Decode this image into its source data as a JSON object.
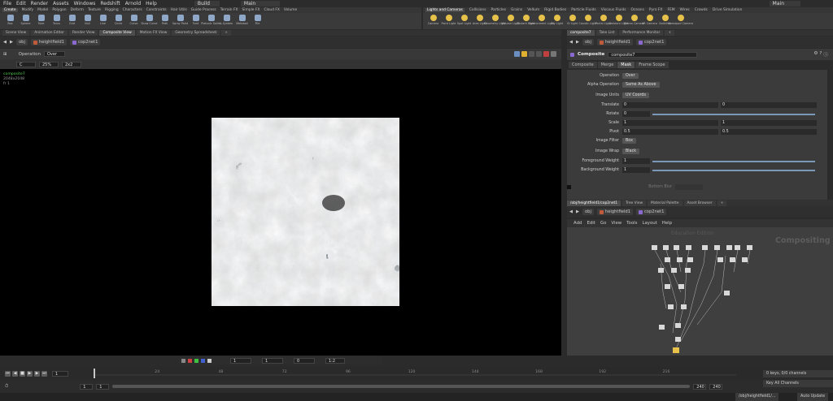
{
  "menus": [
    "File",
    "Edit",
    "Render",
    "Assets",
    "Windows",
    "Redshift",
    "Arnold",
    "Help"
  ],
  "desktop": "Build",
  "network_context": "Main",
  "user": "Main",
  "shelf_tabs_left": [
    "Create",
    "Modify",
    "Model",
    "Polygon",
    "Deform",
    "Texture",
    "Rigging",
    "Characters",
    "Constraints",
    "Hair Utils",
    "Guide Process",
    "Terrain FX",
    "Simple FX",
    "Cloud FX",
    "Volume"
  ],
  "shelf_tabs_right": [
    "Lights and Cameras",
    "Collisions",
    "Particles",
    "Grains",
    "Vellum",
    "Rigid Bodies",
    "Particle Fluids",
    "Viscous Fluids",
    "Oceans",
    "Pyro FX",
    "FEM",
    "Wires",
    "Crowds",
    "Drive Simulation"
  ],
  "shelf_tools_left": [
    "Box",
    "Sphere",
    "Tube",
    "Torus",
    "Grid",
    "Null",
    "Line",
    "Circle",
    "Curve",
    "Draw Curve",
    "Path",
    "Spray Paint",
    "Font",
    "Platonic Solids",
    "L-System",
    "Metaball",
    "File"
  ],
  "shelf_tools_right": [
    "Camera",
    "Point Light",
    "Spot Light",
    "Area Light",
    "Geometry Light",
    "Volume Light",
    "Distant Light",
    "Environment Light",
    "Sky Light",
    "GI Light",
    "Caustic Light",
    "Portal Light",
    "Ambient Light",
    "Stereo Camera",
    "VR Camera",
    "Switcher",
    "Gamepad Camera"
  ],
  "pane_tabs_left": [
    "Scene View",
    "Animation Editor",
    "Render View",
    "Composite View",
    "Motion FX View",
    "Geometry Spreadsheet"
  ],
  "path_left": [
    "obj",
    "heightfield1",
    "cop2net1"
  ],
  "viewer": {
    "operation_label": "Operation",
    "operation": "Over",
    "channel": "C",
    "zoom": "25%",
    "frame": "2x2"
  },
  "viewport_info": {
    "node": "composite7",
    "res": "2048x2048",
    "line3": "fr 1"
  },
  "viewport_bottom": {
    "field1": "1",
    "field2": "1",
    "field3": "0",
    "ratio": "1:2"
  },
  "pane_tabs_right": [
    "composite7",
    "Take List",
    "Performance Monitor"
  ],
  "path_right": [
    "obj",
    "heightfield1",
    "cop2net1"
  ],
  "node_type": "Composite",
  "node_name": "composite7",
  "param_tabs": [
    "Composite",
    "Merge",
    "Mask",
    "Frame Scope"
  ],
  "params": [
    {
      "label": "Operation",
      "type": "menu",
      "value": "Over"
    },
    {
      "label": "Alpha Operation",
      "type": "menu",
      "value": "Same As Above"
    },
    {
      "label": "Image Units",
      "type": "menu",
      "value": "UV Coords"
    },
    {
      "label": "Translate",
      "type": "vec2",
      "v1": "0",
      "v2": "0"
    },
    {
      "label": "Rotate",
      "type": "slider",
      "v1": "0"
    },
    {
      "label": "Scale",
      "type": "vec2",
      "v1": "1",
      "v2": "1"
    },
    {
      "label": "Pivot",
      "type": "vec2",
      "v1": "0.5",
      "v2": "0.5"
    },
    {
      "label": "Image Filter",
      "type": "menu",
      "value": "Box"
    },
    {
      "label": "Image Wrap",
      "type": "menu",
      "value": "Black"
    },
    {
      "label": "Foreground Weight",
      "type": "slider",
      "v1": "1"
    },
    {
      "label": "Background Weight",
      "type": "slider",
      "v1": "1"
    },
    {
      "label": "Bottom Blur",
      "type": "dim",
      "v1": ""
    }
  ],
  "net_tabs": [
    "/obj/heightfield1/cop2net1",
    "Tree View",
    "Material Palette",
    "Asset Browser"
  ],
  "net_path": [
    "obj",
    "heightfield1",
    "cop2net1"
  ],
  "net_menu": [
    "Add",
    "Edit",
    "Go",
    "View",
    "Tools",
    "Layout",
    "Help"
  ],
  "net_watermark": "Compositing",
  "net_watermark2": "Education Edition",
  "timeline": {
    "frame": "1",
    "ticks": [
      "24",
      "48",
      "72",
      "96",
      "120",
      "144",
      "168",
      "192",
      "216"
    ],
    "start": "1",
    "start2": "1",
    "end": "240",
    "end2": "240"
  },
  "channels": {
    "keys": "0 keys, 0/0 channels",
    "key_all": "Key All Channels"
  },
  "status": {
    "path": "/obj/heightfield1/...",
    "auto_update": "Auto Update"
  },
  "colors": {
    "accent": "#e6c24a",
    "node_name": "#4ecb4e",
    "bg": "#2b2b2b"
  }
}
